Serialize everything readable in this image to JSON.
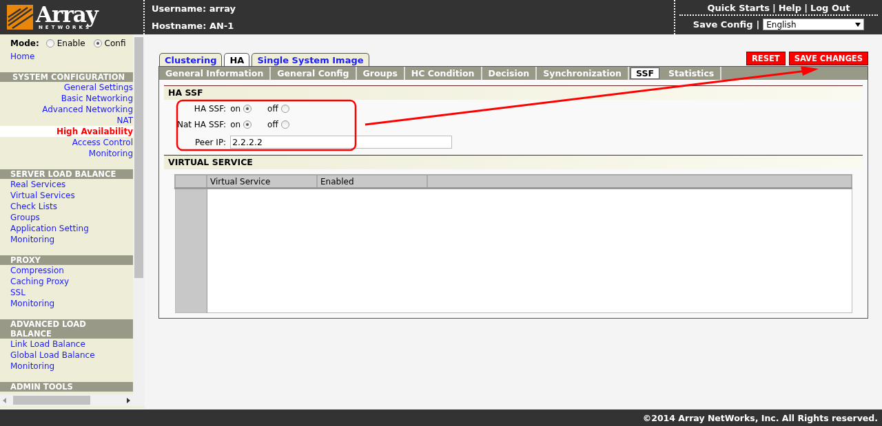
{
  "header": {
    "logo": {
      "name": "Array",
      "tagline": "NETWORKS"
    },
    "username": "Username: array",
    "hostname": "Hostname: AN-1",
    "links": [
      "Quick Starts",
      "Help",
      "Log Out"
    ],
    "separators": [
      "|",
      "|"
    ],
    "save_config": {
      "label": "Save Config",
      "separator": "|"
    },
    "language": "English"
  },
  "sidebar": {
    "mode": {
      "label": "Mode:",
      "options": [
        {
          "label": "Enable",
          "selected": false
        },
        {
          "label": "Confi",
          "selected": true
        }
      ]
    },
    "home": "Home",
    "sections": [
      {
        "title": "SYSTEM CONFIGURATION",
        "right_aligned": true,
        "items": [
          {
            "label": "General Settings",
            "selected": false
          },
          {
            "label": "Basic Networking",
            "selected": false
          },
          {
            "label": "Advanced Networking",
            "selected": false
          },
          {
            "label": "NAT",
            "selected": false
          },
          {
            "label": "High Availability",
            "selected": true
          },
          {
            "label": "Access Control",
            "selected": false
          },
          {
            "label": "Monitoring",
            "selected": false
          }
        ]
      },
      {
        "title": "SERVER LOAD BALANCE",
        "right_aligned": false,
        "items": [
          {
            "label": "Real Services",
            "selected": false
          },
          {
            "label": "Virtual Services",
            "selected": false
          },
          {
            "label": "Check Lists",
            "selected": false
          },
          {
            "label": "Groups",
            "selected": false
          },
          {
            "label": "Application Setting",
            "selected": false
          },
          {
            "label": "Monitoring",
            "selected": false
          }
        ]
      },
      {
        "title": "PROXY",
        "right_aligned": false,
        "items": [
          {
            "label": "Compression",
            "selected": false
          },
          {
            "label": "Caching Proxy",
            "selected": false
          },
          {
            "label": "SSL",
            "selected": false
          },
          {
            "label": "Monitoring",
            "selected": false
          }
        ]
      },
      {
        "title": "ADVANCED LOAD BALANCE",
        "right_aligned": false,
        "items": [
          {
            "label": "Link Load Balance",
            "selected": false
          },
          {
            "label": "Global Load Balance",
            "selected": false
          },
          {
            "label": "Monitoring",
            "selected": false
          }
        ]
      },
      {
        "title": "ADMIN TOOLS"
      }
    ]
  },
  "main": {
    "tabs": [
      {
        "label": "Clustering",
        "selected": false
      },
      {
        "label": "HA",
        "selected": true
      },
      {
        "label": "Single System Image",
        "selected": false
      }
    ],
    "subtabs": [
      {
        "label": "General Information",
        "selected": false
      },
      {
        "label": "General Config",
        "selected": false
      },
      {
        "label": "Groups",
        "selected": false
      },
      {
        "label": "HC Condition",
        "selected": false
      },
      {
        "label": "Decision",
        "selected": false
      },
      {
        "label": "Synchronization",
        "selected": false
      },
      {
        "label": "SSF",
        "selected": true
      },
      {
        "label": "Statistics",
        "selected": false
      }
    ],
    "buttons": [
      "RESET",
      "SAVE CHANGES"
    ],
    "ha_ssf": {
      "title": "HA SSF",
      "fields": [
        {
          "label": "HA SSF:",
          "kind": "radio",
          "options": [
            {
              "label": "on",
              "selected": true
            },
            {
              "label": "off",
              "selected": false
            }
          ]
        },
        {
          "label": "Nat HA SSF:",
          "kind": "radio",
          "options": [
            {
              "label": "on",
              "selected": true
            },
            {
              "label": "off",
              "selected": false
            }
          ]
        },
        {
          "label": "Peer IP:",
          "kind": "text",
          "value": "2.2.2.2"
        }
      ]
    },
    "virtual_service": {
      "title": "VIRTUAL SERVICE",
      "columns": [
        "Virtual Service",
        "Enabled"
      ]
    }
  },
  "footer": "©2014 Array NetWorks, Inc. All Rights reserved."
}
